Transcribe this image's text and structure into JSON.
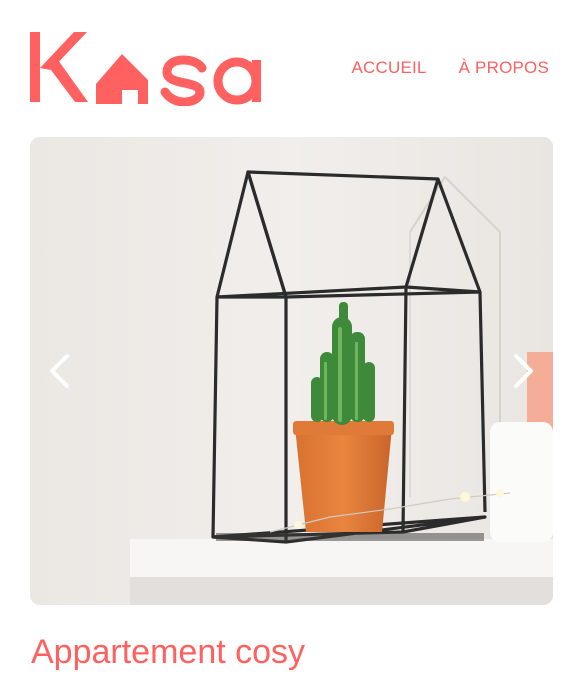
{
  "brand": {
    "logo_text": "Kasa",
    "color": "#FF6060"
  },
  "nav": {
    "items": [
      {
        "label": "ACCUEIL"
      },
      {
        "label": "À PROPOS"
      }
    ]
  },
  "gallery": {
    "image_icon": "cactus-house-photo",
    "prev_icon": "chevron-left-icon",
    "next_icon": "chevron-right-icon"
  },
  "listing": {
    "title": "Appartement cosy"
  }
}
